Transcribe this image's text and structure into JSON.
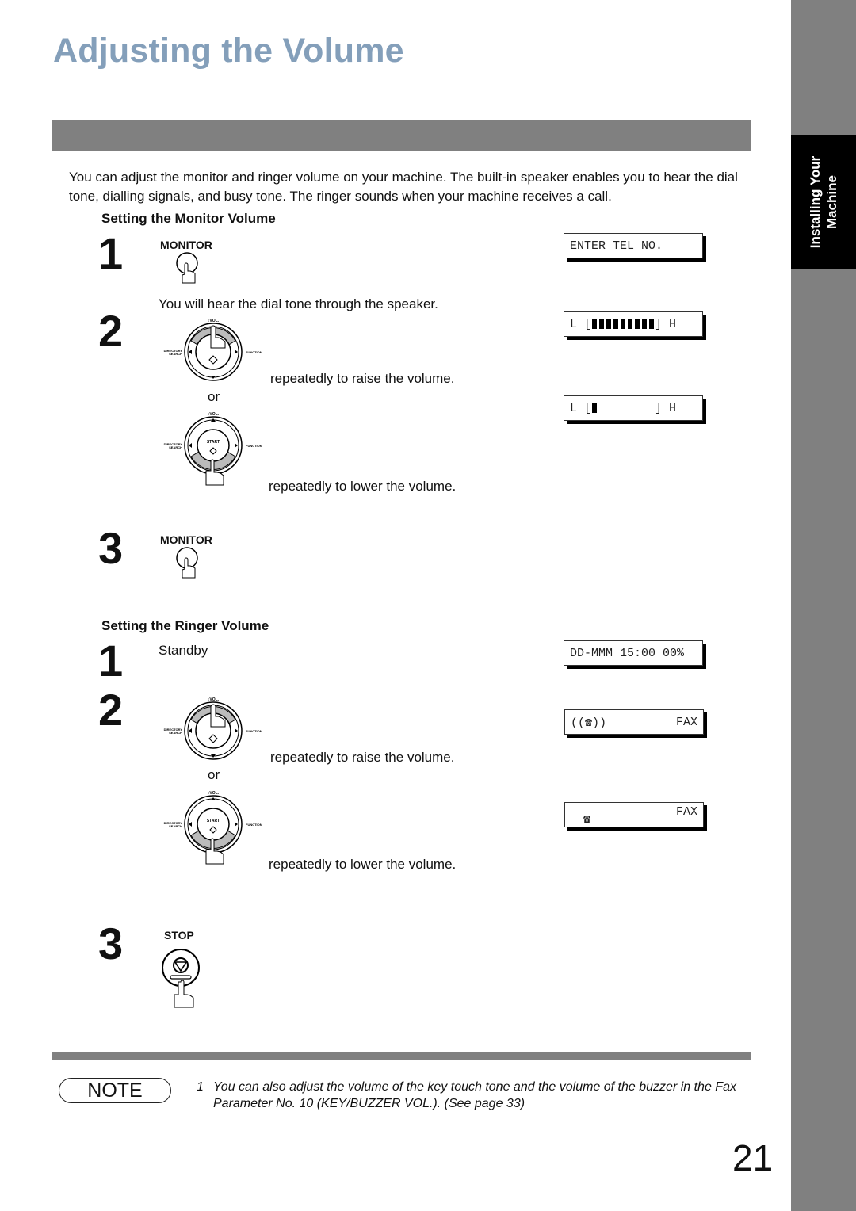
{
  "page": {
    "title": "Adjusting the Volume",
    "side_tab": {
      "line1": "Installing Your",
      "line2": "Machine"
    },
    "intro": "You can adjust the monitor and ringer volume on your machine. The built-in speaker enables you to hear the dial tone, dialling signals, and busy tone. The ringer sounds when your machine receives a call.",
    "page_number": "21"
  },
  "monitor_section": {
    "heading": "Setting the Monitor Volume",
    "steps": [
      {
        "num": "1",
        "key_label": "MONITOR",
        "display": "ENTER TEL NO."
      },
      {
        "num": "2",
        "text": "You will hear the dial tone through the speaker.",
        "raise_text": "repeatedly to raise the volume.",
        "or_text": "or",
        "lower_text": "repeatedly to lower the volume.",
        "display_high": {
          "left": "L [",
          "right": "] H",
          "level": 9,
          "max": 9
        },
        "display_low": {
          "left": "L [",
          "right": "] H",
          "level": 1,
          "max": 9
        }
      },
      {
        "num": "3",
        "key_label": "MONITOR"
      }
    ]
  },
  "ringer_section": {
    "heading": "Setting the Ringer Volume",
    "steps": [
      {
        "num": "1",
        "text": "Standby",
        "display": "DD-MMM 15:00 00%"
      },
      {
        "num": "2",
        "raise_text": "repeatedly to raise the volume.",
        "or_text": "or",
        "lower_text": "repeatedly to lower the volume.",
        "display_high": {
          "left": "((",
          "right": "))",
          "mode": "FAX"
        },
        "display_low": {
          "mode": "FAX"
        }
      },
      {
        "num": "3",
        "key_label": "STOP"
      }
    ]
  },
  "dial_pad": {
    "vol_label": "VOL.",
    "left_label_1": "DIRECTORY",
    "left_label_2": "SEARCH",
    "right_label": "FUNCTION",
    "center_label": "START"
  },
  "note": {
    "label": "NOTE",
    "items": [
      {
        "num": "1",
        "text": "You can also adjust the volume of the key touch tone and the volume of the buzzer in the Fax Parameter No. 10 (KEY/BUZZER VOL.).  (See page 33)"
      }
    ]
  }
}
